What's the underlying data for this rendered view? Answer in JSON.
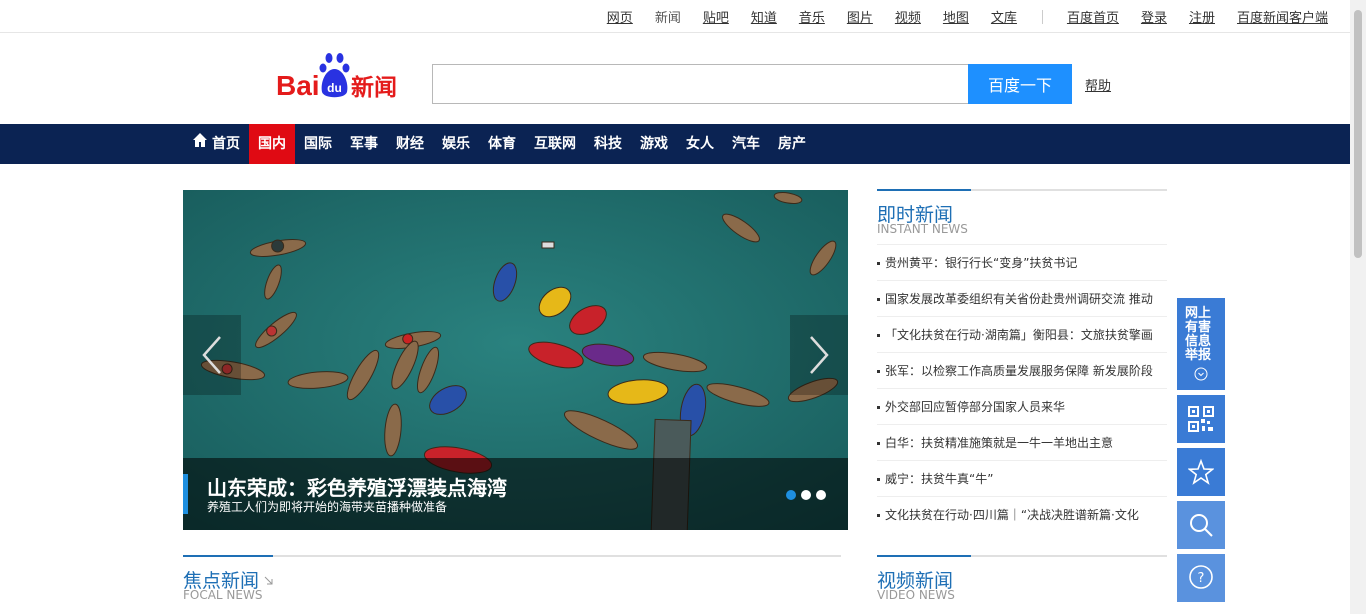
{
  "topbar": {
    "links": [
      "网页",
      "新闻",
      "贴吧",
      "知道",
      "音乐",
      "图片",
      "视频",
      "地图",
      "文库"
    ],
    "current": "新闻",
    "right_links": [
      "百度首页",
      "登录",
      "注册",
      "百度新闻客户端"
    ]
  },
  "logo": {
    "text_bai": "Bai",
    "text_du": "du",
    "text_news": "新闻"
  },
  "search": {
    "value": "",
    "button_label": "百度一下",
    "help_label": "帮助"
  },
  "nav": {
    "items": [
      "首页",
      "国内",
      "国际",
      "军事",
      "财经",
      "娱乐",
      "体育",
      "互联网",
      "科技",
      "游戏",
      "女人",
      "汽车",
      "房产"
    ],
    "active": "国内"
  },
  "carousel": {
    "title": "山东荣成：彩色养殖浮漂装点海湾",
    "subtitle": "养殖工人们为即将开始的海带夹苗播种做准备",
    "slides": 3,
    "current_slide": 1
  },
  "instant_news": {
    "title": "即时新闻",
    "subtitle": "INSTANT NEWS",
    "items": [
      "贵州黄平：银行行长“变身”扶贫书记",
      "国家发展改革委组织有关省份赴贵州调研交流 推动",
      "「文化扶贫在行动·湖南篇」衡阳县：文旅扶贫擎画",
      "张军：以检察工作高质量发展服务保障 新发展阶段",
      "外交部回应暂停部分国家人员来华",
      "白华：扶贫精准施策就是一牛一羊地出主意",
      "威宁：扶贫牛真“牛”",
      "文化扶贫在行动·四川篇｜“决战决胜谱新篇·文化"
    ]
  },
  "focal_news": {
    "title": "焦点新闻",
    "subtitle": "FOCAL NEWS"
  },
  "video_news": {
    "title": "视频新闻",
    "subtitle": "VIDEO NEWS"
  },
  "float": {
    "report_label": "网上有害信息举报"
  },
  "colors": {
    "nav_bg": "#0b2353",
    "nav_active": "#e00a13",
    "accent": "#1e6fb5",
    "float_bg": "#3a7bd5"
  }
}
